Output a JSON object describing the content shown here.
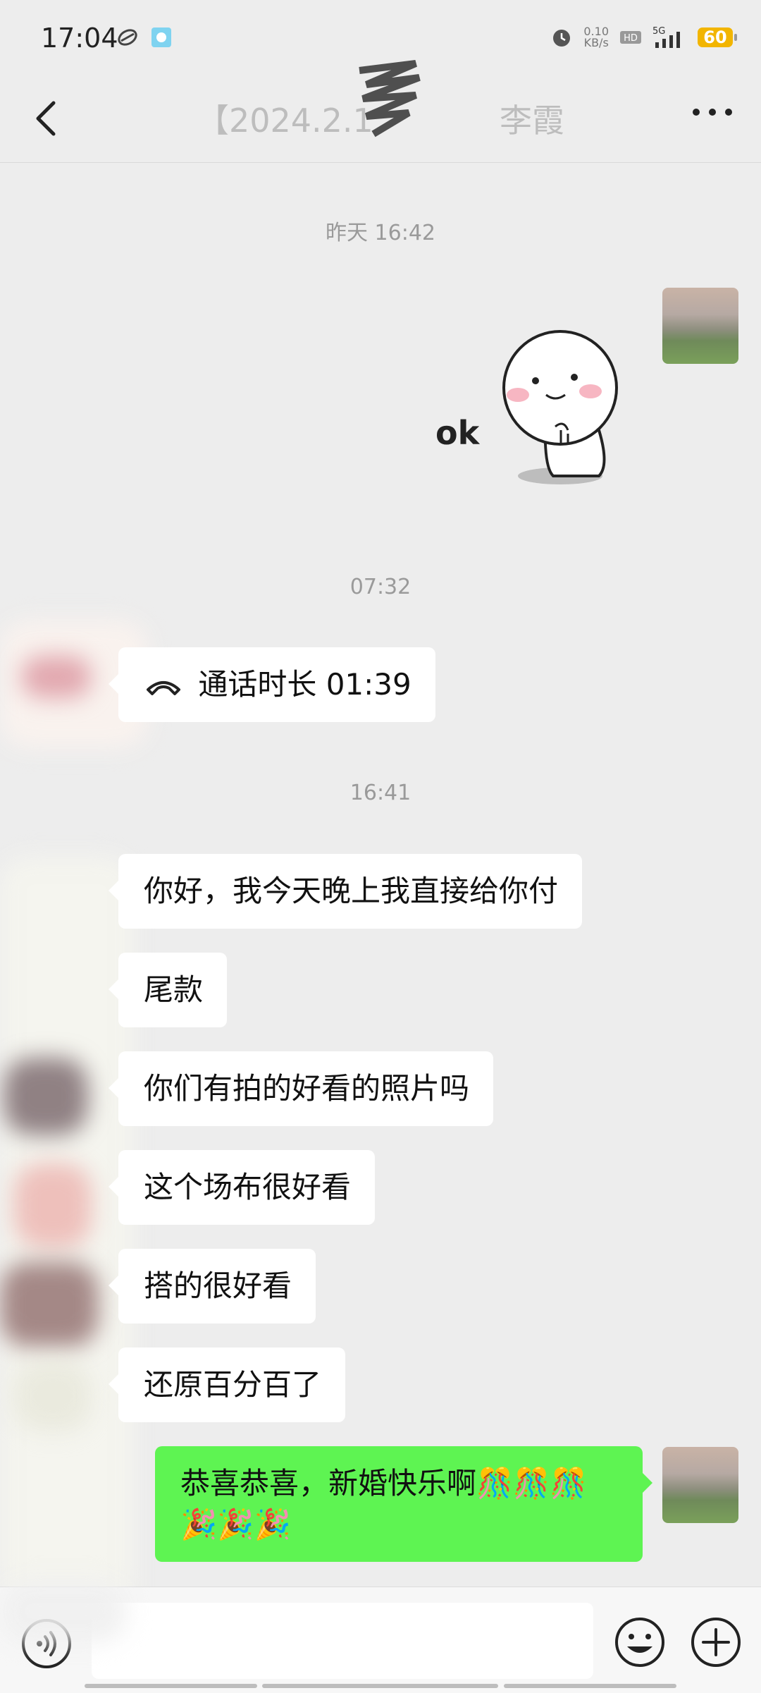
{
  "status_bar": {
    "time": "17:04",
    "net_speed_value": "0.10",
    "net_speed_unit": "KB/s",
    "network": "5G",
    "battery": "60"
  },
  "header": {
    "title": "【2024.2.1",
    "title_suffix": "李霞",
    "back_icon": "chevron-left-icon",
    "more_icon": "more-dots-icon"
  },
  "timestamps": [
    "昨天 16:42",
    "07:32",
    "16:41"
  ],
  "messages": {
    "sticker_text": "ok",
    "call": {
      "label": "通话时长 01:39",
      "icon": "phone-call-icon"
    },
    "texts": [
      "你好，我今天晚上我直接给你付",
      "尾款",
      "你们有拍的好看的照片吗",
      "这个场布很好看",
      "搭的很好看",
      "还原百分百了"
    ],
    "reply": "恭喜恭喜，新婚快乐啊🎊🎊🎊🎉🎉🎉"
  },
  "input_bar": {
    "placeholder": "",
    "voice_icon": "voice-icon",
    "emoji_icon": "emoji-icon",
    "plus_icon": "plus-icon"
  },
  "colors": {
    "background": "#ededed",
    "sent_bubble": "#5ef452",
    "received_bubble": "#ffffff",
    "battery": "#f2b500"
  }
}
